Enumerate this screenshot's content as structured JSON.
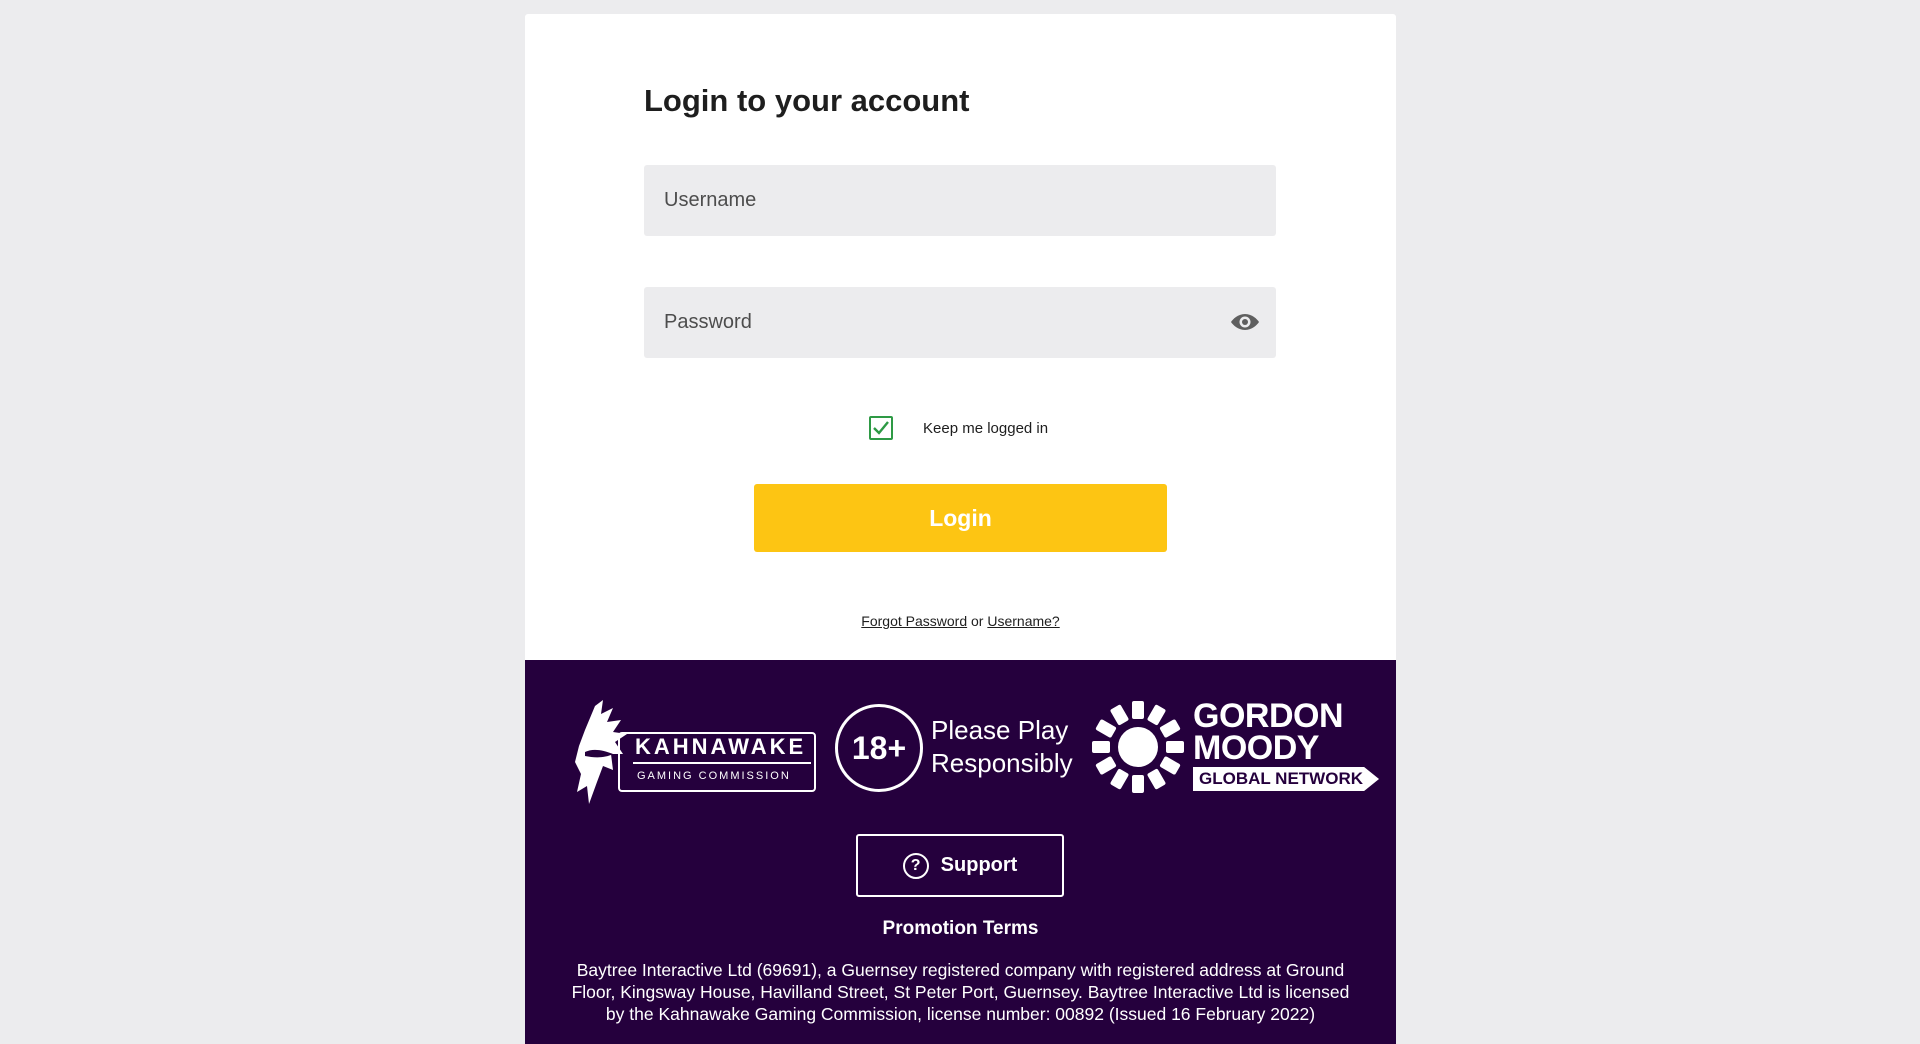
{
  "login": {
    "title": "Login to your account",
    "username_placeholder": "Username",
    "password_placeholder": "Password",
    "keep_logged_in_label": "Keep me logged in",
    "keep_logged_in_checked": true,
    "login_button": "Login",
    "forgot_password_link": "Forgot Password",
    "or_text": "or",
    "username_link": "Username?"
  },
  "footer": {
    "kahnawake_name": "KAHNAWAKE",
    "kahnawake_sub": "GAMING COMMISSION",
    "age_badge": "18+",
    "play_line1": "Please Play",
    "play_line2": "Responsibly",
    "gordon_line1": "GORDON",
    "gordon_line2": "MOODY",
    "gordon_tag": "GLOBAL NETWORK",
    "support_button": "Support",
    "promotion_terms": "Promotion Terms",
    "legal_text": "Baytree Interactive Ltd (69691), a Guernsey registered company with registered address at Ground Floor, Kingsway House, Havilland Street, St Peter Port, Guernsey. Baytree Interactive Ltd is licensed by the Kahnawake Gaming Commission, license number: 00892 (Issued 16 February 2022)"
  },
  "colors": {
    "background": "#ececee",
    "accent_yellow": "#fdc513",
    "footer_purple": "#25003d",
    "checkbox_green": "#2e9a45"
  },
  "icons": {
    "password_toggle": "eye-icon",
    "checkbox": "checkmark-icon",
    "support": "question-circle-icon"
  }
}
